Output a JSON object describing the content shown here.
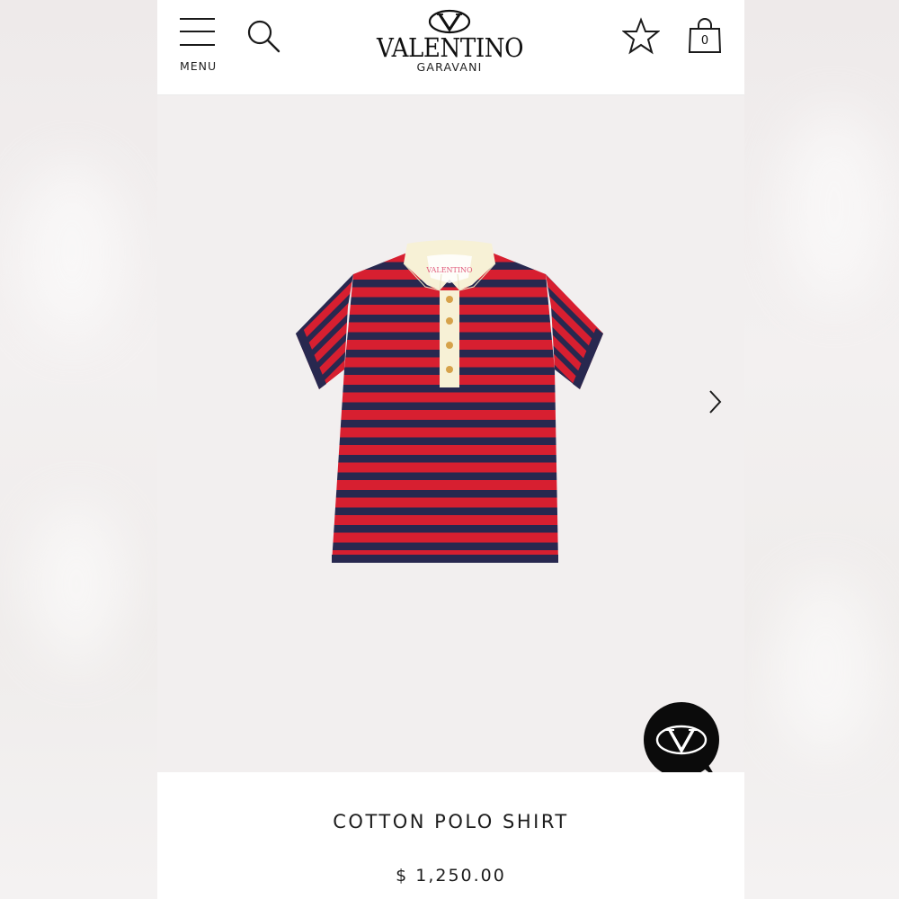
{
  "header": {
    "menu_label": "MENU",
    "brand_name": "VALENTINO",
    "brand_sub": "GARAVANI",
    "bag_count": "0"
  },
  "gallery": {
    "image_alt": "Red and navy striped cotton polo shirt with cream collar",
    "collar_label": "VALENTINO"
  },
  "product": {
    "name": "COTTON POLO SHIRT",
    "price": "$ 1,250.00"
  },
  "icons": {
    "menu": "hamburger-icon",
    "search": "search-icon",
    "wishlist": "star-icon",
    "bag": "shopping-bag-icon",
    "next": "chevron-right-icon",
    "chat": "vlogo-chat-icon"
  },
  "colors": {
    "stripe_red": "#d71f30",
    "stripe_navy": "#28284f",
    "collar_cream": "#f7f1d6",
    "background": "#f2efef"
  }
}
